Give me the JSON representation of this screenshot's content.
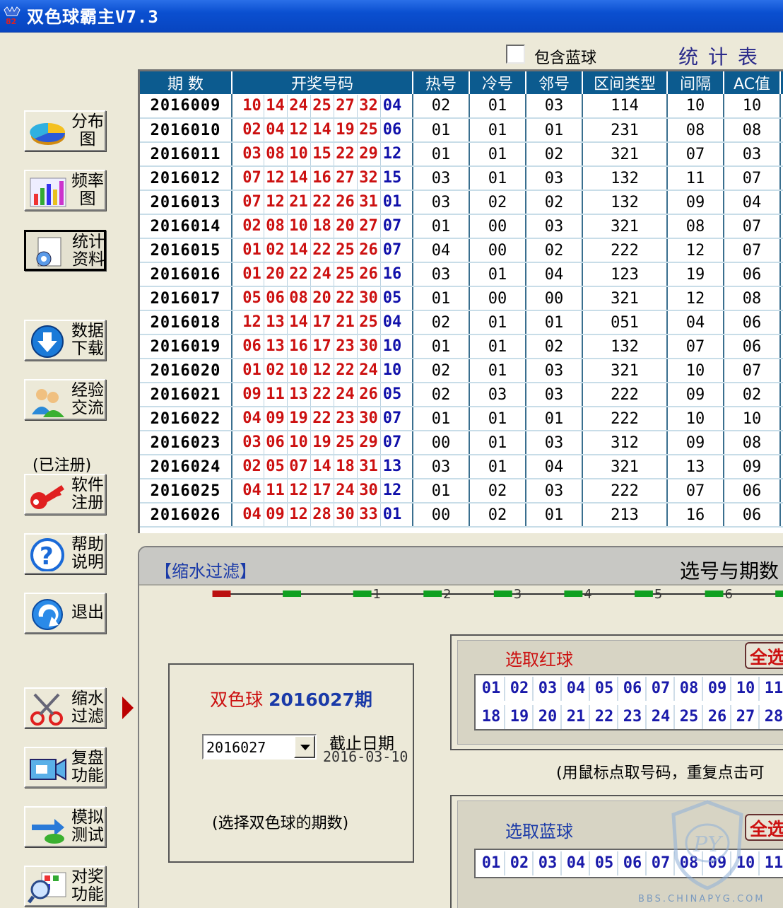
{
  "window": {
    "title": "双色球霸主V7.3"
  },
  "options": {
    "include_blue_label": "包含蓝球",
    "include_blue_checked": false
  },
  "stats_title": "统计表",
  "table": {
    "headers": [
      "期 数",
      "开奖号码",
      "热号",
      "冷号",
      "邻号",
      "区间类型",
      "间隔",
      "AC值"
    ],
    "rows": [
      {
        "period": "2016009",
        "red": [
          "10",
          "14",
          "24",
          "25",
          "27",
          "32"
        ],
        "blue": "04",
        "hot": "02",
        "cold": "01",
        "adj": "03",
        "zone": "114",
        "gap": "10",
        "ac": "10"
      },
      {
        "period": "2016010",
        "red": [
          "02",
          "04",
          "12",
          "14",
          "19",
          "25"
        ],
        "blue": "06",
        "hot": "01",
        "cold": "01",
        "adj": "01",
        "zone": "231",
        "gap": "08",
        "ac": "08"
      },
      {
        "period": "2016011",
        "red": [
          "03",
          "08",
          "10",
          "15",
          "22",
          "29"
        ],
        "blue": "12",
        "hot": "01",
        "cold": "01",
        "adj": "02",
        "zone": "321",
        "gap": "07",
        "ac": "03"
      },
      {
        "period": "2016012",
        "red": [
          "07",
          "12",
          "14",
          "16",
          "27",
          "32"
        ],
        "blue": "15",
        "hot": "03",
        "cold": "01",
        "adj": "03",
        "zone": "132",
        "gap": "11",
        "ac": "07"
      },
      {
        "period": "2016013",
        "red": [
          "07",
          "12",
          "21",
          "22",
          "26",
          "31"
        ],
        "blue": "01",
        "hot": "03",
        "cold": "02",
        "adj": "02",
        "zone": "132",
        "gap": "09",
        "ac": "04"
      },
      {
        "period": "2016014",
        "red": [
          "02",
          "08",
          "10",
          "18",
          "20",
          "27"
        ],
        "blue": "07",
        "hot": "01",
        "cold": "00",
        "adj": "03",
        "zone": "321",
        "gap": "08",
        "ac": "07"
      },
      {
        "period": "2016015",
        "red": [
          "01",
          "02",
          "14",
          "22",
          "25",
          "26"
        ],
        "blue": "07",
        "hot": "04",
        "cold": "00",
        "adj": "02",
        "zone": "222",
        "gap": "12",
        "ac": "07"
      },
      {
        "period": "2016016",
        "red": [
          "01",
          "20",
          "22",
          "24",
          "25",
          "26"
        ],
        "blue": "16",
        "hot": "03",
        "cold": "01",
        "adj": "04",
        "zone": "123",
        "gap": "19",
        "ac": "06"
      },
      {
        "period": "2016017",
        "red": [
          "05",
          "06",
          "08",
          "20",
          "22",
          "30"
        ],
        "blue": "05",
        "hot": "01",
        "cold": "00",
        "adj": "00",
        "zone": "321",
        "gap": "12",
        "ac": "08"
      },
      {
        "period": "2016018",
        "red": [
          "12",
          "13",
          "14",
          "17",
          "21",
          "25"
        ],
        "blue": "04",
        "hot": "02",
        "cold": "01",
        "adj": "01",
        "zone": "051",
        "gap": "04",
        "ac": "06"
      },
      {
        "period": "2016019",
        "red": [
          "06",
          "13",
          "16",
          "17",
          "23",
          "30"
        ],
        "blue": "10",
        "hot": "01",
        "cold": "01",
        "adj": "02",
        "zone": "132",
        "gap": "07",
        "ac": "06"
      },
      {
        "period": "2016020",
        "red": [
          "01",
          "02",
          "10",
          "12",
          "22",
          "24"
        ],
        "blue": "10",
        "hot": "02",
        "cold": "01",
        "adj": "03",
        "zone": "321",
        "gap": "10",
        "ac": "07"
      },
      {
        "period": "2016021",
        "red": [
          "09",
          "11",
          "13",
          "22",
          "24",
          "26"
        ],
        "blue": "05",
        "hot": "02",
        "cold": "03",
        "adj": "03",
        "zone": "222",
        "gap": "09",
        "ac": "02"
      },
      {
        "period": "2016022",
        "red": [
          "04",
          "09",
          "19",
          "22",
          "23",
          "30"
        ],
        "blue": "07",
        "hot": "01",
        "cold": "01",
        "adj": "01",
        "zone": "222",
        "gap": "10",
        "ac": "10"
      },
      {
        "period": "2016023",
        "red": [
          "03",
          "06",
          "10",
          "19",
          "25",
          "29"
        ],
        "blue": "07",
        "hot": "00",
        "cold": "01",
        "adj": "03",
        "zone": "312",
        "gap": "09",
        "ac": "08"
      },
      {
        "period": "2016024",
        "red": [
          "02",
          "05",
          "07",
          "14",
          "18",
          "31"
        ],
        "blue": "13",
        "hot": "03",
        "cold": "01",
        "adj": "04",
        "zone": "321",
        "gap": "13",
        "ac": "09"
      },
      {
        "period": "2016025",
        "red": [
          "04",
          "11",
          "12",
          "17",
          "24",
          "30"
        ],
        "blue": "12",
        "hot": "01",
        "cold": "02",
        "adj": "03",
        "zone": "222",
        "gap": "07",
        "ac": "06"
      },
      {
        "period": "2016026",
        "red": [
          "04",
          "09",
          "12",
          "28",
          "30",
          "33"
        ],
        "blue": "01",
        "hot": "00",
        "cold": "02",
        "adj": "01",
        "zone": "213",
        "gap": "16",
        "ac": "06"
      }
    ]
  },
  "sidebar": {
    "registered_text": "(已注册)",
    "buttons": [
      {
        "id": "distribution",
        "label1": "分布",
        "label2": "图",
        "icon": "pie-chart-icon"
      },
      {
        "id": "frequency",
        "label1": "频率",
        "label2": "图",
        "icon": "bar-chart-icon"
      },
      {
        "id": "statistics",
        "label1": "统计",
        "label2": "资料",
        "icon": "gear-document-icon"
      },
      {
        "id": "download",
        "label1": "数据",
        "label2": "下载",
        "icon": "download-arrow-icon"
      },
      {
        "id": "community",
        "label1": "经验",
        "label2": "交流",
        "icon": "users-icon"
      },
      {
        "id": "register",
        "label1": "软件",
        "label2": "注册",
        "icon": "key-icon"
      },
      {
        "id": "help",
        "label1": "帮助",
        "label2": "说明",
        "icon": "question-icon"
      },
      {
        "id": "exit",
        "label1": "退出",
        "label2": "",
        "icon": "exit-arrow-icon"
      },
      {
        "id": "filter",
        "label1": "缩水",
        "label2": "过滤",
        "icon": "scissors-icon"
      },
      {
        "id": "replay",
        "label1": "复盘",
        "label2": "功能",
        "icon": "video-camera-icon"
      },
      {
        "id": "simulate",
        "label1": "模拟",
        "label2": "测试",
        "icon": "swap-arrows-icon"
      },
      {
        "id": "prize",
        "label1": "对奖",
        "label2": "功能",
        "icon": "magnifier-grid-icon"
      }
    ]
  },
  "filter_panel": {
    "title": "【缩水过滤】",
    "right_text": "选号与期数",
    "steps": [
      "1",
      "2",
      "3",
      "4",
      "5",
      "6"
    ],
    "issue_prefix": "双色球",
    "issue_number": "2016027期",
    "selected_period": "2016027",
    "deadline_label": "截止日期",
    "deadline_value": "2016-03-10",
    "period_hint": "(选择双色球的期数)"
  },
  "red_select": {
    "title": "选取红球",
    "select_all": "全选",
    "row1": [
      "01",
      "02",
      "03",
      "04",
      "05",
      "06",
      "07",
      "08",
      "09",
      "10",
      "11"
    ],
    "row2": [
      "18",
      "19",
      "20",
      "21",
      "22",
      "23",
      "24",
      "25",
      "26",
      "27",
      "28"
    ]
  },
  "mouse_hint": "(用鼠标点取号码，重复点击可",
  "blue_select": {
    "title": "选取蓝球",
    "select_all": "全选",
    "row1": [
      "01",
      "02",
      "03",
      "04",
      "05",
      "06",
      "07",
      "08",
      "09",
      "10",
      "11"
    ]
  },
  "watermark": {
    "text": "BBS.CHINAPYG.COM",
    "logo_letters": "PY"
  },
  "colors": {
    "header_bg": "#0c5b8f",
    "red_ball": "#cc1010",
    "blue_ball": "#1010aa",
    "title_bar": "#0a4fd0"
  }
}
